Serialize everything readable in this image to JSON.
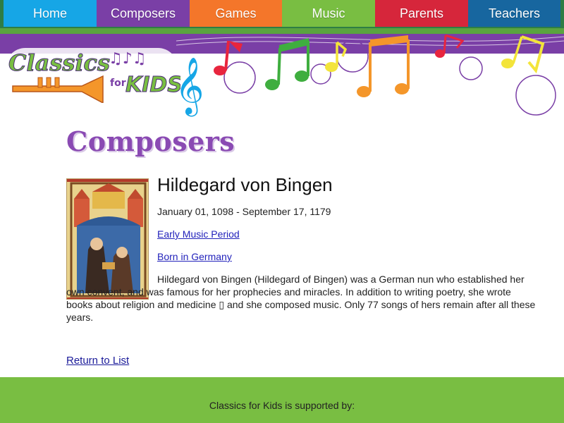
{
  "nav": {
    "items": [
      {
        "label": "Home",
        "color": "#16a6e6"
      },
      {
        "label": "Composers",
        "color": "#7a3fa6"
      },
      {
        "label": "Games",
        "color": "#f4762a"
      },
      {
        "label": "Music",
        "color": "#79be42"
      },
      {
        "label": "Parents",
        "color": "#d6263b"
      },
      {
        "label": "Teachers",
        "color": "#17669f"
      }
    ]
  },
  "logo": {
    "line1": "Classics",
    "line2": "for",
    "line3": "KIDS"
  },
  "page": {
    "heading": "Composers"
  },
  "composer": {
    "name": "Hildegard von Bingen",
    "dates": "January 01, 1098 - September 17, 1179",
    "period_link": "Early Music Period",
    "born_link": "Born in Germany",
    "bio": "Hildegard von Bingen (Hildegard of Bingen) was a German nun who established her own convent, and was famous for her prophecies and miracles. In addition to writing poetry, she wrote books about religion and medicine ▯ and she composed music. Only 77 songs of hers remain after all these years."
  },
  "return_link": "Return to List",
  "footer": {
    "supported_by": "Classics for Kids is supported by:"
  },
  "colors": {
    "purple": "#7a3fa6",
    "green": "#79be42",
    "link": "#2222bb"
  }
}
